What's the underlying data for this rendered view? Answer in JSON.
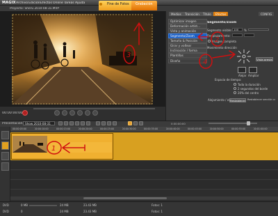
{
  "menubar": {
    "logo": "MAGIX",
    "items": [
      "Archivo",
      "Edición",
      "Efectos",
      "Online",
      "Tareas",
      "Ayuda"
    ]
  },
  "project_title": "Proyecto: Sheru 2010-08-31.MVP",
  "mode_tabs": [
    "Fine de Fotos",
    "Grabación"
  ],
  "effects_panel": {
    "tabs": [
      "Medios",
      "Transición",
      "Título",
      "Efectos"
    ],
    "dongle_tab": "CONFIG",
    "left_items": [
      "Optimizar imagen",
      "Deformación artíst...",
      "Vista y animación",
      "Segmento/Zoom",
      "Tamaño & Posición",
      "Girar y voltear",
      "Inclinación / forma",
      "Plantillas",
      "Diseño"
    ],
    "section_title": "Segmento/Zoom",
    "zoom_label": "Segmento visible:",
    "zoom_value": "100",
    "zoom_suffix": "%",
    "offset_label": "Desplazamiento:",
    "fill_label": "Imagen completa",
    "direction_label": "Movimiento dirección",
    "preview_button": "Vista previa",
    "zoom_in_label": "Alejar",
    "zoom_out_label": "Ampliar",
    "time_label": "Espacio de tiempo:",
    "time_options": [
      "Toda la duración",
      "2 segundos del borde",
      "20% del centro"
    ],
    "bottom_left": "Alejamiento / zoom:",
    "reset_button": "Restablecer",
    "reset_note": "Restablecer sección completa"
  },
  "preview": {
    "timecode": "00:00:00:00"
  },
  "timeline": {
    "presentation_label": "Presentación:",
    "presentation_value": "Show 2010-08-31",
    "clip_name": "",
    "position_label": "0:00:00:00",
    "ruler_ticks": [
      "00:00:05:00",
      "00:00:10:00",
      "00:00:15:00",
      "00:00:20:00",
      "00:00:25:00",
      "00:00:30:00",
      "00:00:35:00",
      "00:00:40:00",
      "00:00:45:00",
      "00:00:50:00",
      "00:00:55:00",
      "00:01:00:00"
    ]
  },
  "status": {
    "row1": [
      "DVD",
      "0 MB",
      "",
      "24 MB",
      "",
      "23.43 MB",
      "",
      "Fotos: 1"
    ],
    "row2": [
      "DVD",
      "0",
      "",
      "24 MB",
      "",
      "23.43 MB",
      "",
      "Fotos: 1"
    ]
  },
  "annotations": [
    "1",
    "2",
    "3",
    "4"
  ],
  "colors": {
    "accent": "#f0a020",
    "selected": "#1a5dc0",
    "annotation": "#d01010"
  }
}
